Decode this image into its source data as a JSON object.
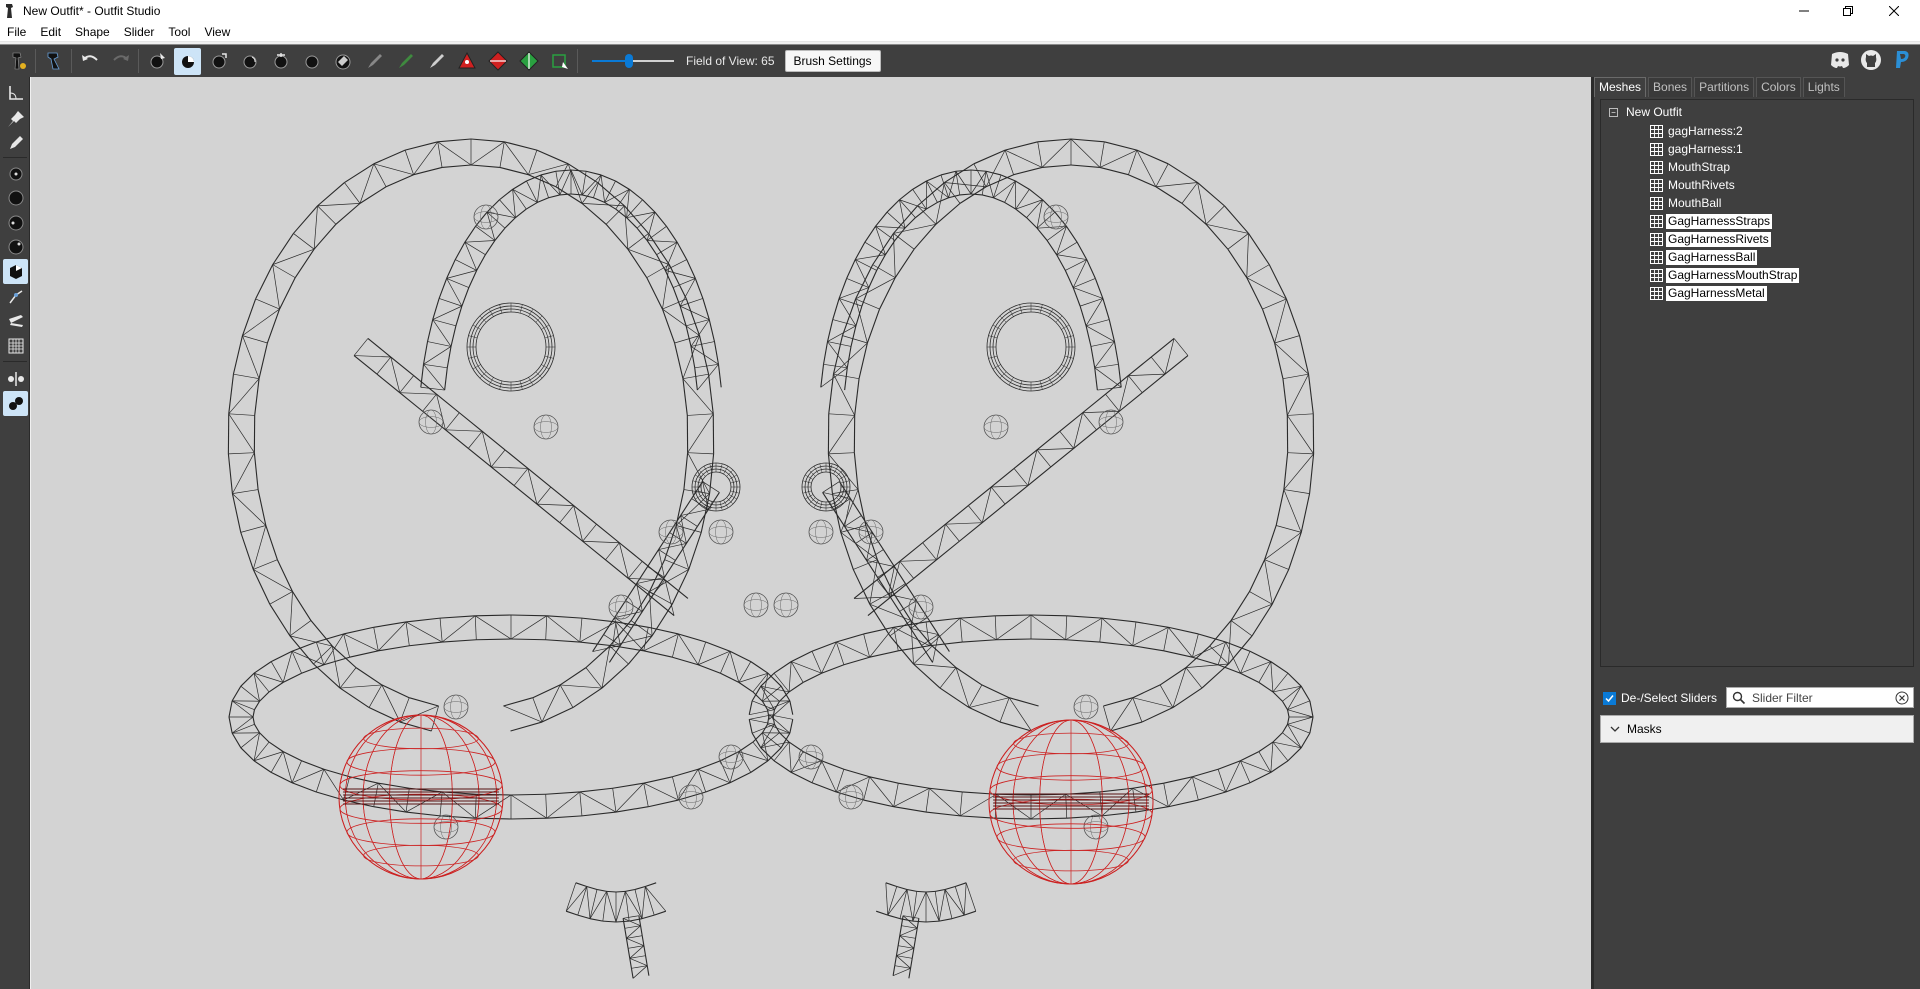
{
  "window": {
    "title": "New Outfit* - Outfit Studio",
    "controls": {
      "minimize_icon": "minimize-icon",
      "maximize_icon": "restore-icon",
      "close_icon": "close-icon"
    }
  },
  "menu": [
    "File",
    "Edit",
    "Shape",
    "Slider",
    "Tool",
    "View"
  ],
  "toolbar": {
    "fov_label": "Field of View: 65",
    "fov_value": 65,
    "fov_fraction": 0.45,
    "brush_settings_label": "Brush Settings",
    "accent_color": "#0a7ad6",
    "right_icons": [
      "discord-icon",
      "github-icon",
      "paypal-icon"
    ]
  },
  "right_panel": {
    "tabs": [
      "Meshes",
      "Bones",
      "Partitions",
      "Colors",
      "Lights"
    ],
    "active_tab": "Meshes",
    "tree": {
      "root": "New Outfit",
      "items": [
        {
          "label": "gagHarness:2",
          "selected": false
        },
        {
          "label": "gagHarness:1",
          "selected": false
        },
        {
          "label": "MouthStrap",
          "selected": false
        },
        {
          "label": "MouthRivets",
          "selected": false
        },
        {
          "label": "MouthBall",
          "selected": false
        },
        {
          "label": "GagHarnessStraps",
          "selected": true
        },
        {
          "label": "GagHarnessRivets",
          "selected": true
        },
        {
          "label": "GagHarnessBall",
          "selected": true
        },
        {
          "label": "GagHarnessMouthStrap",
          "selected": true
        },
        {
          "label": "GagHarnessMetal",
          "selected": true
        }
      ]
    },
    "sliders": {
      "deselect_label": "De-/Select Sliders",
      "deselect_checked": true,
      "filter_placeholder": "Slider Filter",
      "masks_label": "Masks"
    }
  },
  "viewport": {
    "background": "#d3d3d3",
    "wire_color": "#2a2a2a",
    "ball_color": "#cc2222"
  }
}
